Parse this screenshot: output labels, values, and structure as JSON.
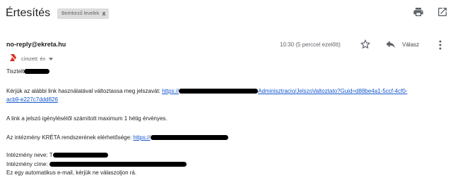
{
  "header": {
    "subject": "Értesítés",
    "label": "Beérkező levelek",
    "label_remove": "x"
  },
  "message": {
    "sender": "no-reply@ekreta.hu",
    "date": "10:30 (5 perccel ezelőtt)",
    "reply_label": "Válasz",
    "recipient": "címzett: én",
    "greeting": "Tisztelt",
    "paragraph1_text": "Kérjük az alábbi link használatával változtassa meg jelszavát: ",
    "paragraph1_link_start": "https://",
    "paragraph1_link_end": "Adminisztracio/JelszoValtoztato?Guid=d88be4a1-5ccf-4cf0-",
    "paragraph1_link_line2": "acb9-e227c7ddd826",
    "paragraph2": "A link a jelszó igénylésétől számított maximum 1 hétig érvényes.",
    "paragraph3_text": "Az intézmény KRÉTA rendszerének elérhetősége: ",
    "paragraph3_link": "https://",
    "institution_name_label": "Intézmény neve: T",
    "institution_address_label": "Intézmény címe: ",
    "footer": "Ez egy automatikus e-mail, kérjük ne válaszoljon rá."
  },
  "icons": {
    "print": "print-icon",
    "open_new_window": "open-in-new-icon",
    "star": "star-icon",
    "reply": "reply-icon",
    "more": "more-vert-icon",
    "important": "important-marker-icon"
  },
  "colors": {
    "link": "#1155cc",
    "label_bg": "#dddddd",
    "important_marker": "#d93025"
  }
}
